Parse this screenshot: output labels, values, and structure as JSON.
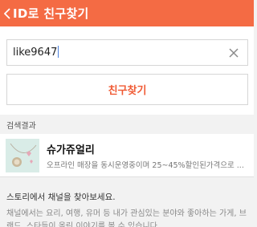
{
  "header": {
    "title": "ID로 친구찾기",
    "back_icon": "chevron-left-icon"
  },
  "search": {
    "value": "like9647",
    "clear_icon": "close-icon"
  },
  "find_button": {
    "label": "친구찾기"
  },
  "results": {
    "section_label": "검색결과",
    "items": [
      {
        "name": "슈가쥬얼리",
        "description": "오프라인 매장을 동시운영중이며 25~45%할인된가격으로 ..."
      }
    ]
  },
  "story": {
    "title": "스토리에서 채널을 찾아보세요.",
    "text": "채널에서는 요리, 여행, 유머 등 내가 관심있는 분야와 좋아하는 가게, 브랜드, 스타들이 올린 이야기를 볼 수 있습니다."
  },
  "colors": {
    "accent": "#f46b44",
    "button_text": "#f05a34"
  }
}
